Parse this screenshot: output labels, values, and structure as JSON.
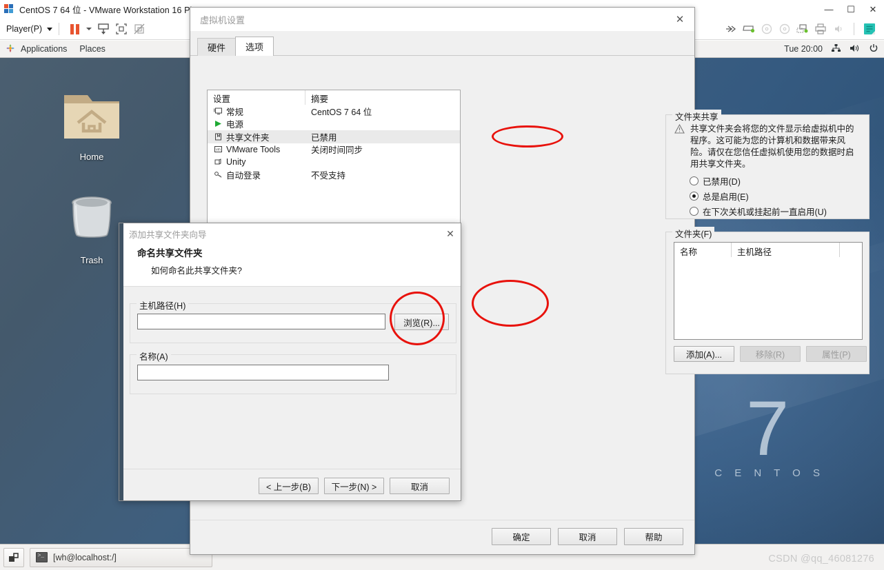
{
  "vmware": {
    "window_title": "CentOS 7 64 位 - VMware Workstation 16 Player",
    "minimize_glyph": "—",
    "maximize_glyph": "☐",
    "close_glyph": "✕",
    "toolbar": {
      "player_menu": "Player(P)",
      "icons": [
        "pause-icon",
        "pause-dropdown-icon",
        "send-ctrl-alt-del-icon",
        "full-screen-icon",
        "unity-mode-icon"
      ],
      "right_icons": [
        "network-icon",
        "hard-disk-icon",
        "cd-drive-icon",
        "cd-drive2-icon",
        "network-adapter-icon",
        "printer-icon",
        "sound-icon",
        "usb-icon"
      ]
    }
  },
  "gnome": {
    "applications": "Applications",
    "places": "Places",
    "clock": "Tue 20:00",
    "tray_icons": [
      "network-icon",
      "volume-icon",
      "power-icon"
    ]
  },
  "desktop": {
    "icons": [
      {
        "name": "Home",
        "icon": "home-folder-icon"
      },
      {
        "name": "Trash",
        "icon": "trash-can-icon"
      }
    ],
    "branding": {
      "number": "7",
      "word": "C E N T O S"
    }
  },
  "taskbar": {
    "show_desktop_icon": "show-desktop-icon",
    "window_button": "[wh@localhost:/]",
    "window_icon": "terminal-icon",
    "watermark": "CSDN @qq_46081276"
  },
  "vm_settings": {
    "title": "虚拟机设置",
    "close_glyph": "✕",
    "tabs": [
      {
        "label": "硬件",
        "active": false
      },
      {
        "label": "选项",
        "active": true
      }
    ],
    "list": {
      "headers": [
        "设置",
        "摘要"
      ],
      "rows": [
        {
          "icon": "monitor-icon",
          "setting": "常规",
          "summary": "CentOS 7 64 位",
          "selected": false
        },
        {
          "icon": "power-icon",
          "setting": "电源",
          "summary": "",
          "selected": false
        },
        {
          "icon": "folder-icon",
          "setting": "共享文件夹",
          "summary": "已禁用",
          "selected": true
        },
        {
          "icon": "vmtools-icon",
          "setting": "VMware Tools",
          "summary": "关闭时间同步",
          "selected": false
        },
        {
          "icon": "unity-icon",
          "setting": "Unity",
          "summary": "",
          "selected": false
        },
        {
          "icon": "autologin-icon",
          "setting": "自动登录",
          "summary": "不受支持",
          "selected": false
        }
      ]
    },
    "folder_sharing": {
      "legend": "文件夹共享",
      "warning_icon": "warning-triangle-icon",
      "warning_text": "共享文件夹会将您的文件显示给虚拟机中的程序。这可能为您的计算机和数据带来风险。请仅在您信任虚拟机使用您的数据时启用共享文件夹。",
      "options": [
        {
          "label": "已禁用(D)",
          "selected": false
        },
        {
          "label": "总是启用(E)",
          "selected": true
        },
        {
          "label": "在下次关机或挂起前一直启用(U)",
          "selected": false
        }
      ]
    },
    "folders": {
      "legend": "文件夹(F)",
      "headers": [
        "名称",
        "主机路径",
        ""
      ],
      "rows": [],
      "buttons": [
        {
          "label": "添加(A)...",
          "enabled": true
        },
        {
          "label": "移除(R)",
          "enabled": false
        },
        {
          "label": "属性(P)",
          "enabled": false
        }
      ]
    },
    "footer_buttons": [
      "确定",
      "取消",
      "帮助"
    ]
  },
  "wizard": {
    "title": "添加共享文件夹向导",
    "close_glyph": "✕",
    "heading": "命名共享文件夹",
    "subheading": "如何命名此共享文件夹?",
    "host_path": {
      "legend": "主机路径(H)",
      "value": "",
      "browse_label": "浏览(R)..."
    },
    "folder_name": {
      "legend": "名称(A)",
      "value": ""
    },
    "footer_buttons": [
      "< 上一步(B)",
      "下一步(N) >",
      "取消"
    ]
  },
  "annotations": {
    "highlight_color": "#e8120c",
    "circles": [
      "总是启用(E) radio option",
      "浏览(R)... button",
      "添加(A)... button"
    ]
  }
}
